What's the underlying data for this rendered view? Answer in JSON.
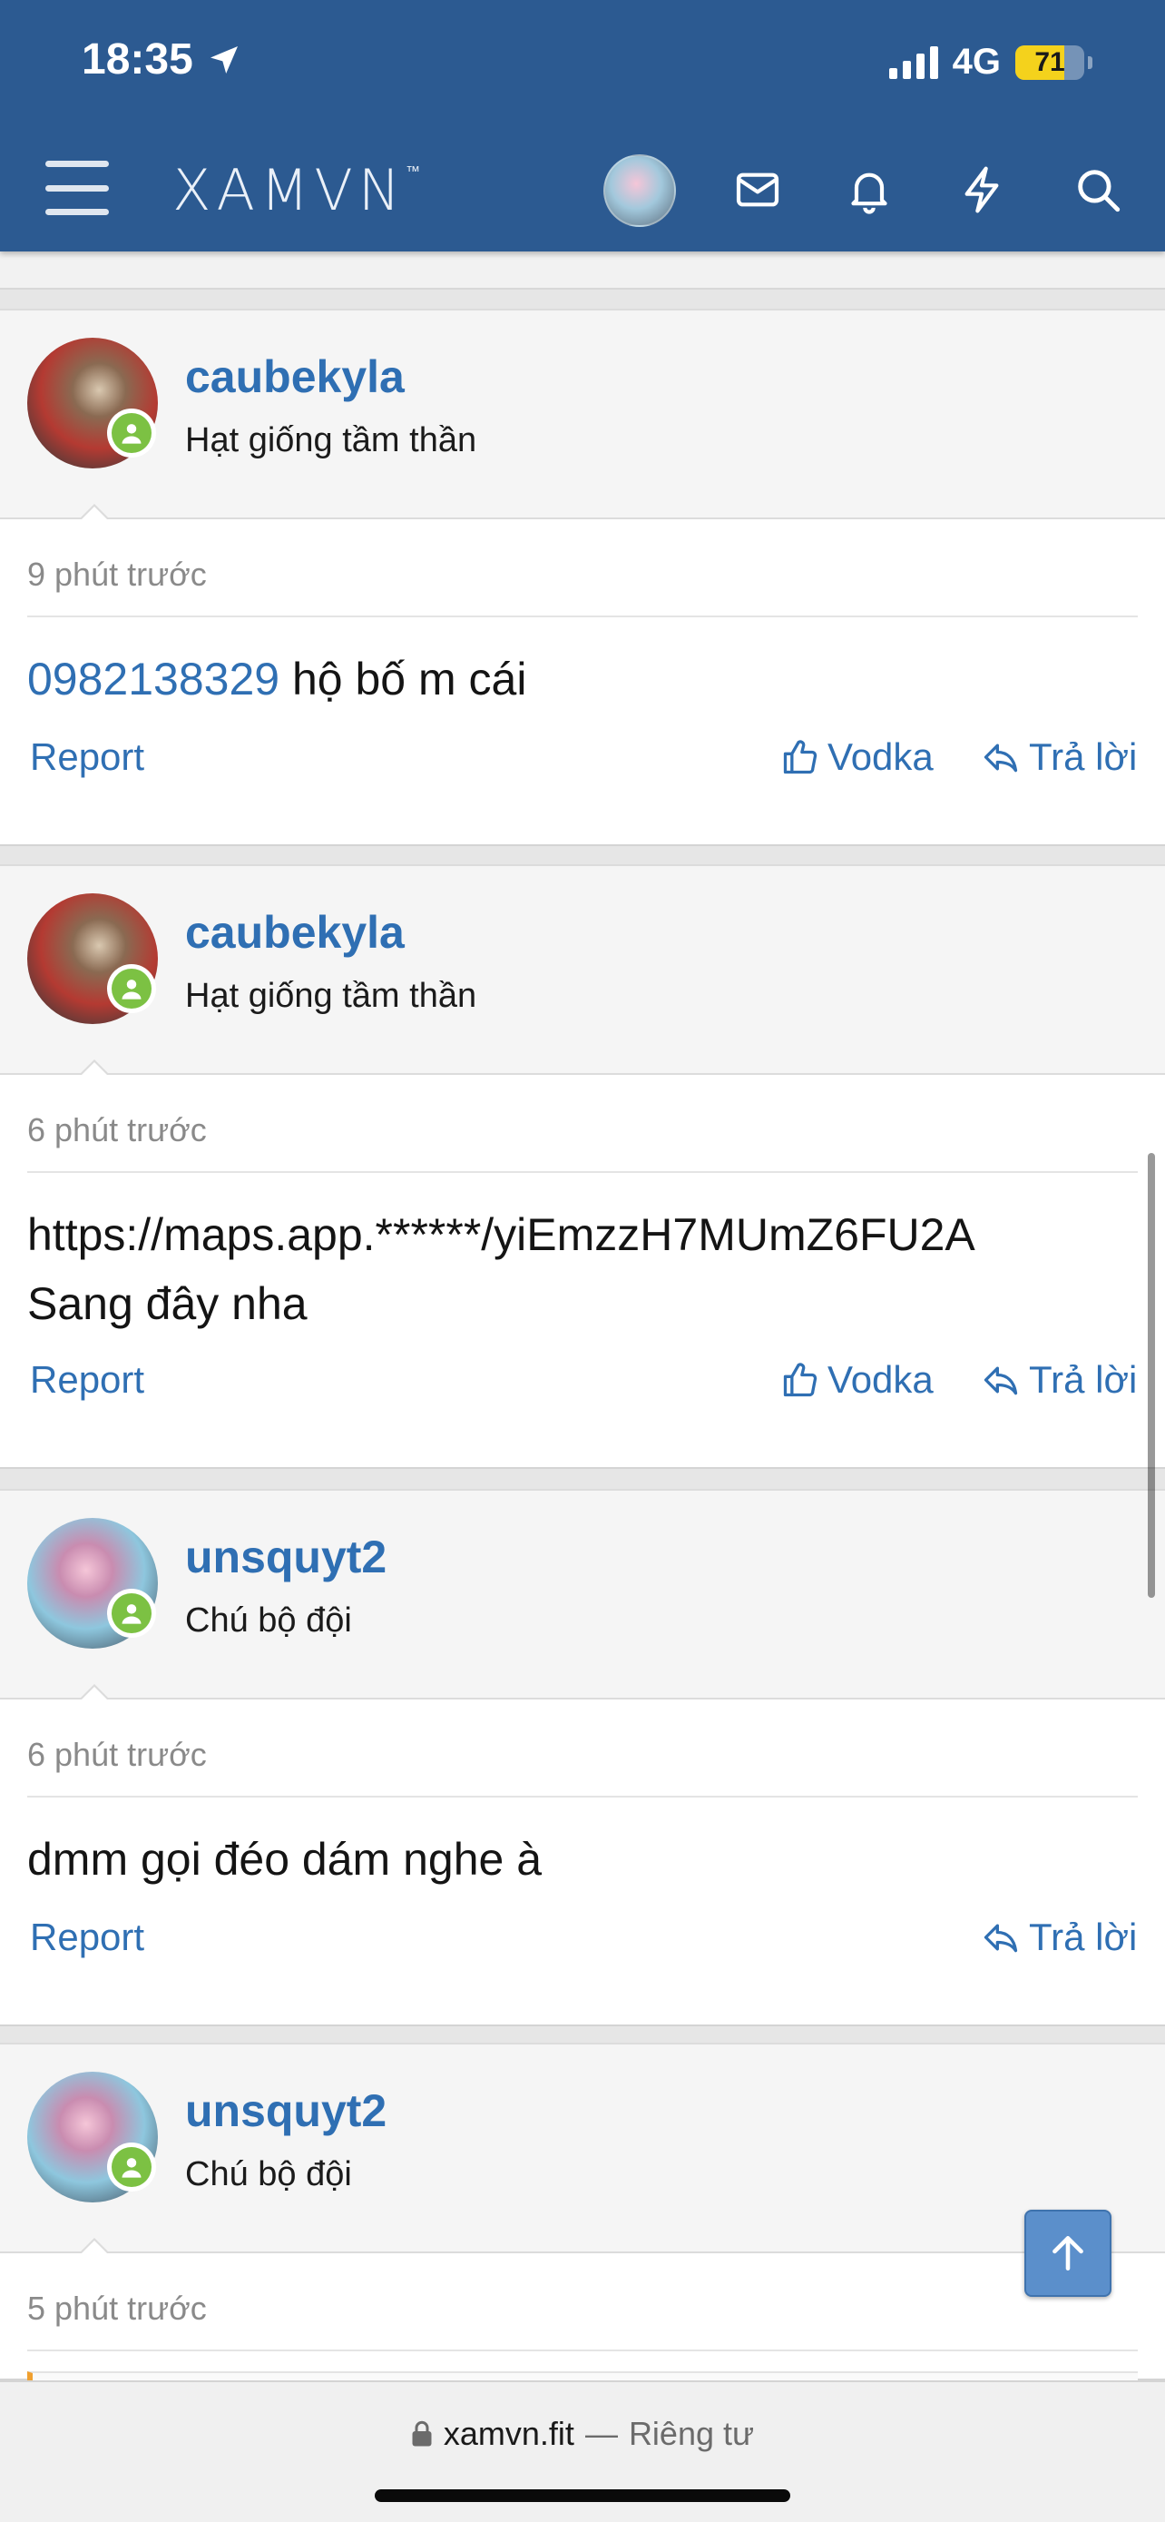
{
  "status_bar": {
    "time": "18:35",
    "network": "4G",
    "battery": "71",
    "battery_level": 0.71
  },
  "header": {
    "logo": "XAMVN",
    "logo_mark": "™"
  },
  "posts": [
    {
      "username": "caubekyla",
      "user_title": "Hạt giống tầm thần",
      "time": "9 phút trước",
      "content_link": "0982138329",
      "content_lines": [
        " hộ bố m cái"
      ],
      "report": "Report",
      "like": "Vodka",
      "reply": "Trả lời"
    },
    {
      "username": "caubekyla",
      "user_title": "Hạt giống tầm thần",
      "time": "6 phút trước",
      "content_lines": [
        "https://maps.app.******/yiEmzzH7MUmZ6FU2A",
        "Sang đây nha"
      ],
      "report": "Report",
      "like": "Vodka",
      "reply": "Trả lời"
    },
    {
      "username": "unsquyt2",
      "user_title": "Chú bộ đội",
      "time": "6 phút trước",
      "content_lines": [
        "dmm gọi đéo dám nghe à"
      ],
      "report": "Report",
      "reply": "Trả lời"
    },
    {
      "username": "unsquyt2",
      "user_title": "Chú bộ đội",
      "time": "5 phút trước"
    }
  ],
  "browser": {
    "domain": "xamvn.fit",
    "separator": "—",
    "privacy": "Riêng tư"
  },
  "colors": {
    "header": "#2c5a91",
    "link": "#2f6fb3",
    "online": "#7cc143",
    "battery": "#f4d21c"
  }
}
